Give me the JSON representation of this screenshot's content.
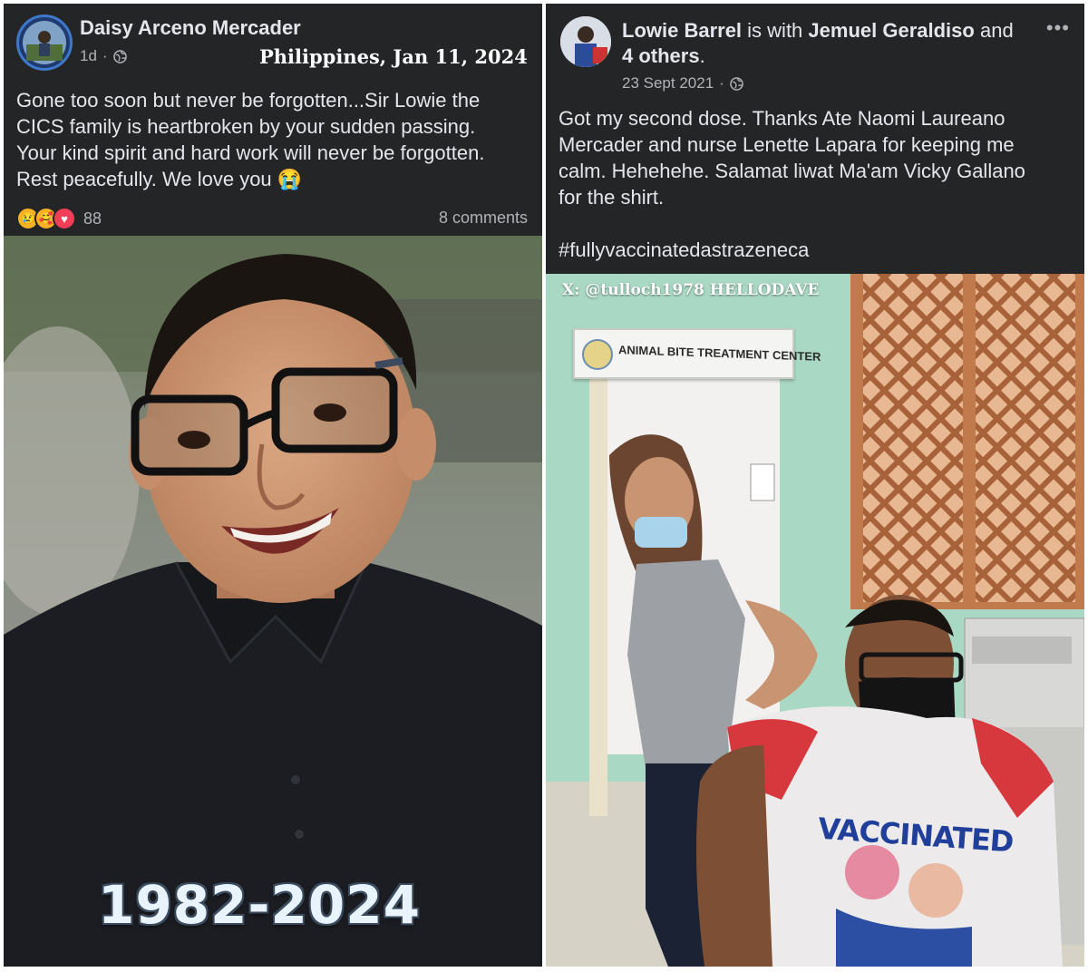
{
  "left_post": {
    "author": "Daisy Arceno Mercader",
    "time": "1d",
    "overlay_date": "Philippines, Jan 11, 2024",
    "text_lines": [
      "Gone too soon but never be forgotten...Sir Lowie the",
      "CICS family is heartbroken by your sudden passing.",
      "Your kind spirit and hard work will never be forgotten.",
      "Rest peacefully. We love you 😭"
    ],
    "reactions": [
      "sad",
      "care",
      "love"
    ],
    "reaction_count": "88",
    "comments": "8 comments",
    "photo_caption": "1982-2024"
  },
  "right_post": {
    "author": "Lowie Barrel",
    "with_text": "is with",
    "tagged": "Jemuel Geraldiso",
    "and_text": "and",
    "others": "4 others",
    "period": ".",
    "date": "23 Sept 2021",
    "more": "•••",
    "text_lines": [
      "Got my second dose. Thanks Ate Naomi Laureano",
      "Mercader and nurse Lenette Lapara  for keeping me",
      "calm. Hehehehe. Salamat liwat Ma'am Vicky Gallano",
      "for the shirt."
    ],
    "hashtag": "#fullyvaccinatedastrazeneca",
    "watermark": "X: @tulloch1978 HELLODAVE",
    "sign_text": "ANIMAL BITE TREATMENT CENTER",
    "shirt_text": "VACCINATED"
  },
  "colors": {
    "card_bg": "#242526",
    "text": "#e4e6eb",
    "secondary_text": "#b0b3b8"
  }
}
